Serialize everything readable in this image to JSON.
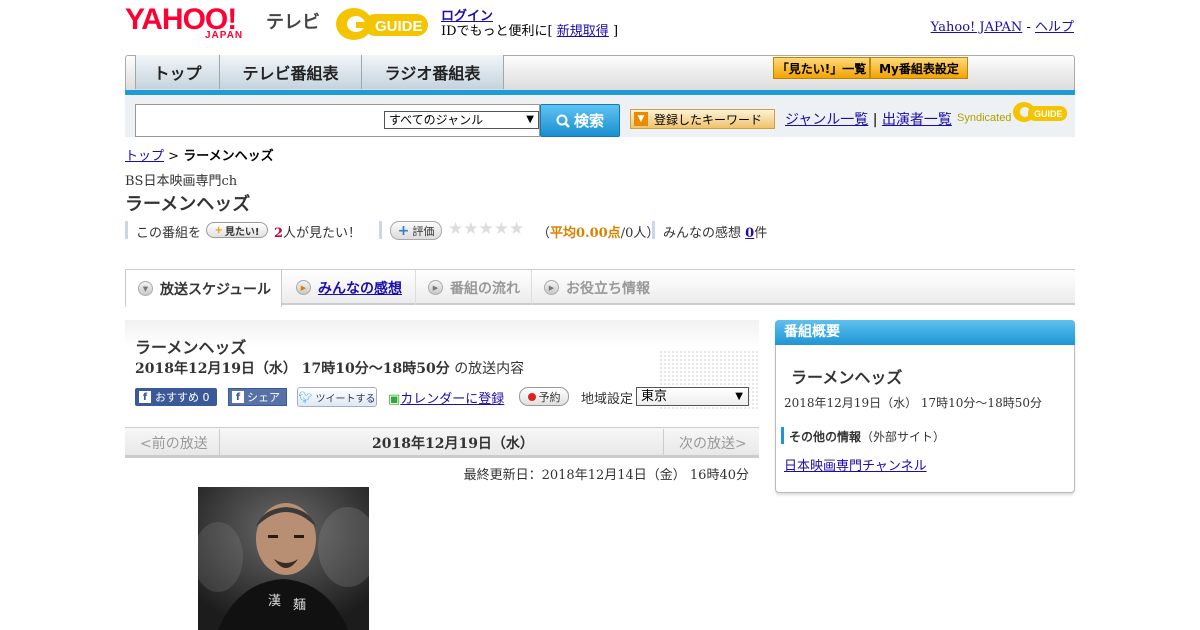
{
  "header": {
    "logo_yahoo": "YAHOO!",
    "logo_japan": "JAPAN",
    "logo_tv": "テレビ",
    "logo_gguide": "GUIDE",
    "login": "ログイン",
    "login_sub_prefix": "IDでもっと便利に[",
    "signup": "新規取得",
    "login_sub_suffix": "]",
    "yahoo_japan": "Yahoo! JAPAN",
    "sep": "-",
    "help": "ヘルプ"
  },
  "nav": {
    "tabs": [
      "トップ",
      "テレビ番組表",
      "ラジオ番組表"
    ],
    "mitai_list": "「見たい!」一覧",
    "my_schedule": "My番組表設定"
  },
  "search": {
    "genre": "すべてのジャンル",
    "button": "検索",
    "keyword_button": "登録したキーワード",
    "genre_list": "ジャンル一覧",
    "pipe": "|",
    "performer_list": "出演者一覧",
    "syndicated": "Syndicated",
    "gguide_small": "GUIDE"
  },
  "breadcrumb": {
    "top": "トップ",
    "sep": ">",
    "current": "ラーメンヘッズ"
  },
  "program": {
    "channel": "BS日本映画専門ch",
    "title": "ラーメンヘッズ"
  },
  "stats": {
    "this_program": "この番組を",
    "mitai_button": "見たい!",
    "mitai_count": "2",
    "mitai_suffix": "人が見たい！",
    "hyoka_button": "評価",
    "stars": "★★★★★",
    "avg_open": "（",
    "avg_label": "平均0.00点",
    "avg_people": "/0人）",
    "impressions_label": "みんなの感想",
    "impressions_count": "0",
    "impressions_suffix": "件"
  },
  "content_tabs": [
    {
      "label": "放送スケジュール"
    },
    {
      "label": "みんなの感想"
    },
    {
      "label": "番組の流れ"
    },
    {
      "label": "お役立ち情報"
    }
  ],
  "schedule": {
    "title": "ラーメンヘッズ",
    "date_time": "2018年12月19日（水） 17時10分～18時50分",
    "date_suffix": "の放送内容",
    "fb_recommend": "おすすめ 0",
    "fb_share": "シェア",
    "tweet": "ツイートする",
    "calendar": "カレンダーに登録",
    "reserve": "予約",
    "region_label": "地域設定",
    "region_value": "東京",
    "prev": "<前の放送",
    "day": "2018年12月19日（水）",
    "next": "次の放送>",
    "updated": "最終更新日：2018年12月14日（金） 16時40分"
  },
  "overview": {
    "header": "番組概要",
    "title": "ラーメンヘッズ",
    "date_time": "2018年12月19日（水） 17時10分～18時50分",
    "other_label": "その他の情報",
    "other_note": "（外部サイト）",
    "link": "日本映画専門チャンネル"
  },
  "colors": {
    "accent_blue": "#1f9bd6",
    "yahoo_red": "#ff0033",
    "gguide_yellow": "#f5c400",
    "orange_button": "#f2a300"
  }
}
